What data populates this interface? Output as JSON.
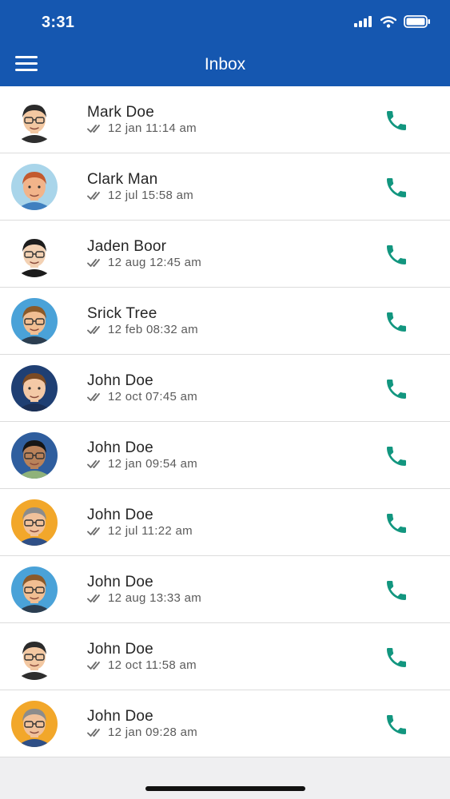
{
  "status_bar": {
    "time": "3:31"
  },
  "header": {
    "title": "Inbox"
  },
  "messages": [
    {
      "name": "Mark Doe",
      "time": "12 jan 11:14 am",
      "avatar": "man-dark-hair-glasses-avatar",
      "bg": "#ffffff",
      "skin": "#f3c8a2",
      "hair": "#2b2b2b",
      "glasses": true,
      "shirt": "#2e2e2e"
    },
    {
      "name": "Clark Man",
      "time": "12 jul 15:58 am",
      "avatar": "man-red-hair-avatar",
      "bg": "#a9d5ea",
      "skin": "#f2b48a",
      "hair": "#c35a2f",
      "glasses": false,
      "shirt": "#3f7fbf"
    },
    {
      "name": "Jaden Boor",
      "time": "12 aug 12:45 am",
      "avatar": "man-black-curly-hair-avatar",
      "bg": "#ffffff",
      "skin": "#f3d1b3",
      "hair": "#1d1d1d",
      "glasses": true,
      "shirt": "#1b1b1b"
    },
    {
      "name": "Srick Tree",
      "time": "12 feb 08:32 am",
      "avatar": "man-sunglasses-beard-avatar",
      "bg": "#4aa2d8",
      "skin": "#f1be92",
      "hair": "#8a5a2b",
      "glasses": true,
      "shirt": "#2c3e50"
    },
    {
      "name": "John Doe",
      "time": "12 oct 07:45 am",
      "avatar": "woman-brown-hair-avatar",
      "bg": "#1f3f73",
      "skin": "#f4c9a6",
      "hair": "#7a4a24",
      "glasses": false,
      "shirt": "#1b2f55"
    },
    {
      "name": "John Doe",
      "time": "12 jan 09:54 am",
      "avatar": "man-beard-glasses-avatar",
      "bg": "#2f5e9e",
      "skin": "#b9825a",
      "hair": "#161616",
      "glasses": true,
      "shirt": "#8fb27a"
    },
    {
      "name": "John Doe",
      "time": "12 jul 11:22 am",
      "avatar": "man-grey-hair-glasses-avatar",
      "bg": "#f2a72a",
      "skin": "#f1c19a",
      "hair": "#8c8c8c",
      "glasses": true,
      "shirt": "#2f4f86"
    },
    {
      "name": "John Doe",
      "time": "12 aug 13:33 am",
      "avatar": "man-sunglasses-beard-avatar",
      "bg": "#4aa2d8",
      "skin": "#f1be92",
      "hair": "#8a5a2b",
      "glasses": true,
      "shirt": "#2c3e50"
    },
    {
      "name": "John Doe",
      "time": "12 oct 11:58 am",
      "avatar": "man-dark-hair-glasses-avatar",
      "bg": "#ffffff",
      "skin": "#f3c8a2",
      "hair": "#2b2b2b",
      "glasses": true,
      "shirt": "#2e2e2e"
    },
    {
      "name": "John Doe",
      "time": "12 jan 09:28 am",
      "avatar": "man-grey-hair-glasses-avatar",
      "bg": "#f2a72a",
      "skin": "#f1c19a",
      "hair": "#8c8c8c",
      "glasses": true,
      "shirt": "#2f4f86"
    }
  ],
  "colors": {
    "header": "#1557b0",
    "call_icon": "#12967f",
    "check_icon": "#6b6b6b"
  },
  "icons": {
    "menu": "hamburger-icon",
    "call": "phone-icon",
    "read": "double-check-icon"
  }
}
